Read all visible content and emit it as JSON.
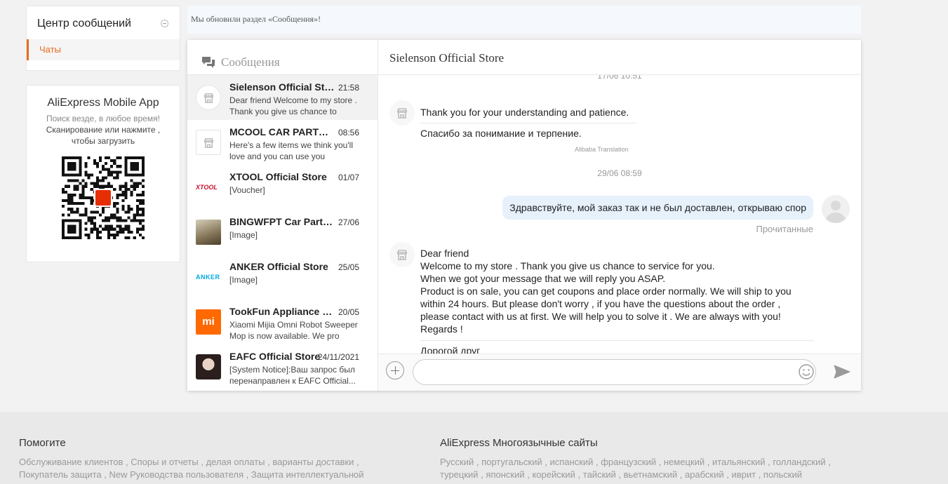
{
  "sidebar": {
    "title": "Центр сообщений",
    "chats_label": "Чаты"
  },
  "app_promo": {
    "title": "AliExpress Mobile App",
    "line1": "Поиск везде, в любое время!",
    "line2": "Сканирование или нажмите , чтобы загрузить"
  },
  "notice": "Мы обновили раздел «Сообщения»!",
  "conversations": {
    "header": "Сообщения",
    "items": [
      {
        "name": "Sielenson Official Store",
        "time": "21:58",
        "preview": "Dear friend Welcome to my store . Thank you give us chance to service for you."
      },
      {
        "name": "MCOOL CAR PARTS Store",
        "time": "08:56",
        "preview": "Here's a few items we think you'll love and you can use you"
      },
      {
        "name": "XTOOL Official Store",
        "time": "01/07",
        "preview": "[Voucher]",
        "logo": "XTOOL"
      },
      {
        "name": "BINGWFPT Car Parts Store",
        "time": "27/06",
        "preview": "[Image]"
      },
      {
        "name": "ANKER Official Store",
        "time": "25/05",
        "preview": "[Image]",
        "logo": "ANKER"
      },
      {
        "name": "TookFun Appliance Store",
        "time": "20/05",
        "preview": "Xiaomi Mijia Omni Robot Sweeper Mop is now available. We pro",
        "logo": "mi"
      },
      {
        "name": "EAFC Official Store",
        "time": "24/11/2021",
        "preview": "[System Notice]:Ваш запрос был перенаправлен к EAFC Official..."
      }
    ]
  },
  "chat": {
    "title": "Sielenson Official Store",
    "timestamp1": "17/06 10:51",
    "msg1_original": "Thank you for your understanding and patience.",
    "msg1_translated": "Спасибо за понимание и терпение.",
    "translation_note": "Alibaba Translation",
    "timestamp2": "29/06 08:59",
    "user_msg": "Здравствуйте, мой заказ так и не был доставлен, открываю спор",
    "read_status": "Прочитанные",
    "msg2_lines": [
      "Dear friend",
      "Welcome to my store . Thank you give us chance to service for you.",
      "When we got your message that we will reply you ASAP.",
      "Product is on sale, you can get coupons and place order normally. We will ship to you",
      "within 24 hours. But please don't worry , if you have the questions about the order ,",
      "please contact with us at first. We will help you to solve it . We are always with you!",
      "Regards !"
    ],
    "msg2_translated_start": "Дорогой друг",
    "input_placeholder": ""
  },
  "colors": {
    "accent": "#e86b1e",
    "user_bubble": "#e6f1fc",
    "ali_red": "#e62e04"
  },
  "footer": {
    "help": {
      "title": "Помогите",
      "line1": "Обслуживание клиентов , Споры и отчеты , делая оплаты , варианты доставки ,",
      "line2": "Покупатель защита , New Руководства пользователя , Защита интеллектуальной"
    },
    "sites": {
      "title": "AliExpress Многоязычные сайты",
      "line1": "Русский , португальский , испанский , французский , немецкий , итальянский , голландский ,",
      "line2": "турецкий , японский , корейский , тайский , вьетнамский , арабский , иврит , польский"
    }
  }
}
